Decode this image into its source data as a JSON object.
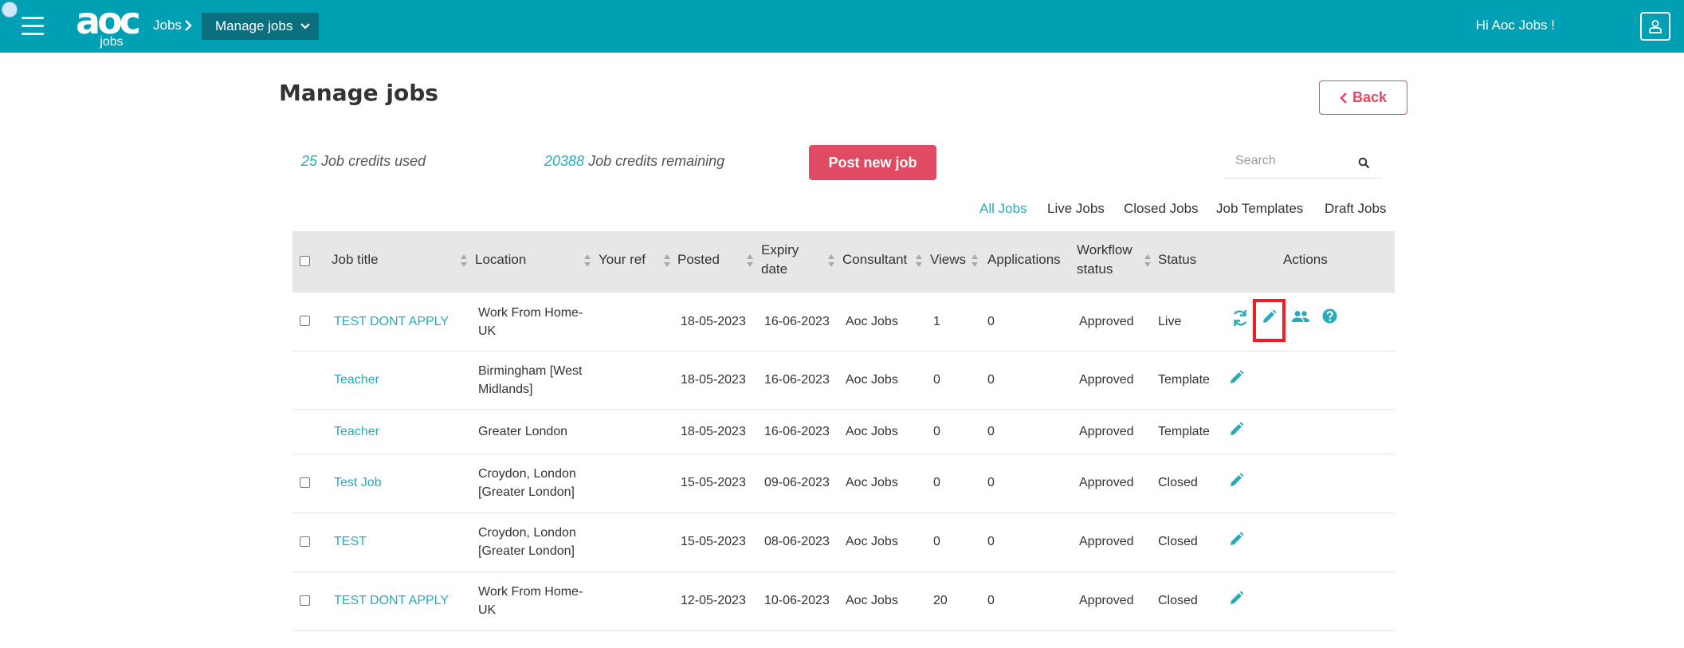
{
  "header": {
    "logo_text": "aoc",
    "logo_sub": "jobs",
    "breadcrumb_root": "Jobs",
    "breadcrumb_current": "Manage jobs",
    "greeting": "Hi Aoc Jobs !"
  },
  "page": {
    "title": "Manage jobs",
    "back_label": "Back"
  },
  "credits": {
    "used_count": "25",
    "used_label": "Job credits used",
    "remaining_count": "20388",
    "remaining_label": "Job credits remaining"
  },
  "post_job_label": "Post new job",
  "search": {
    "placeholder": "Search"
  },
  "filters": [
    "All Jobs",
    "Live Jobs",
    "Closed Jobs",
    "Job Templates",
    "Draft Jobs"
  ],
  "active_filter": "All Jobs",
  "table": {
    "columns": {
      "title": "Job title",
      "location": "Location",
      "ref": "Your ref",
      "posted": "Posted",
      "expiry_1": "Expiry",
      "expiry_2": "date",
      "consultant": "Consultant",
      "views": "Views",
      "applications": "Applications",
      "workflow_1": "Workflow",
      "workflow_2": "status",
      "status": "Status",
      "actions": "Actions"
    },
    "rows": [
      {
        "title": "TEST DONT APPLY",
        "location_1": "Work From Home-",
        "location_2": "UK",
        "ref": "",
        "posted": "18-05-2023",
        "expiry": "16-06-2023",
        "consultant": "Aoc Jobs",
        "views": "1",
        "applications": "0",
        "workflow": "Approved",
        "status": "Live"
      },
      {
        "title": "Teacher",
        "location_1": "Birmingham [West",
        "location_2": "Midlands]",
        "ref": "",
        "posted": "18-05-2023",
        "expiry": "16-06-2023",
        "consultant": "Aoc Jobs",
        "views": "0",
        "applications": "0",
        "workflow": "Approved",
        "status": "Template"
      },
      {
        "title": "Teacher",
        "location_1": "Greater London",
        "location_2": "",
        "ref": "",
        "posted": "18-05-2023",
        "expiry": "16-06-2023",
        "consultant": "Aoc Jobs",
        "views": "0",
        "applications": "0",
        "workflow": "Approved",
        "status": "Template"
      },
      {
        "title": "Test Job",
        "location_1": "Croydon, London",
        "location_2": "[Greater London]",
        "ref": "",
        "posted": "15-05-2023",
        "expiry": "09-06-2023",
        "consultant": "Aoc Jobs",
        "views": "0",
        "applications": "0",
        "workflow": "Approved",
        "status": "Closed"
      },
      {
        "title": "TEST",
        "location_1": "Croydon, London",
        "location_2": "[Greater London]",
        "ref": "",
        "posted": "15-05-2023",
        "expiry": "08-06-2023",
        "consultant": "Aoc Jobs",
        "views": "0",
        "applications": "0",
        "workflow": "Approved",
        "status": "Closed"
      },
      {
        "title": "TEST DONT APPLY",
        "location_1": "Work From Home-",
        "location_2": "UK",
        "ref": "",
        "posted": "12-05-2023",
        "expiry": "10-06-2023",
        "consultant": "Aoc Jobs",
        "views": "20",
        "applications": "0",
        "workflow": "Approved",
        "status": "Closed"
      }
    ]
  },
  "colors": {
    "brand": "#00a0b4",
    "brand_dark": "#0b6f7e",
    "accent": "#e04a62",
    "link": "#2aa9bc",
    "highlight": "#ee1c25"
  },
  "icons": {
    "menu": "hamburger-icon",
    "user": "user-icon",
    "search": "search-icon",
    "repost": "repost-icon",
    "edit": "pencil-icon",
    "applicants": "people-icon",
    "help": "help-icon"
  }
}
